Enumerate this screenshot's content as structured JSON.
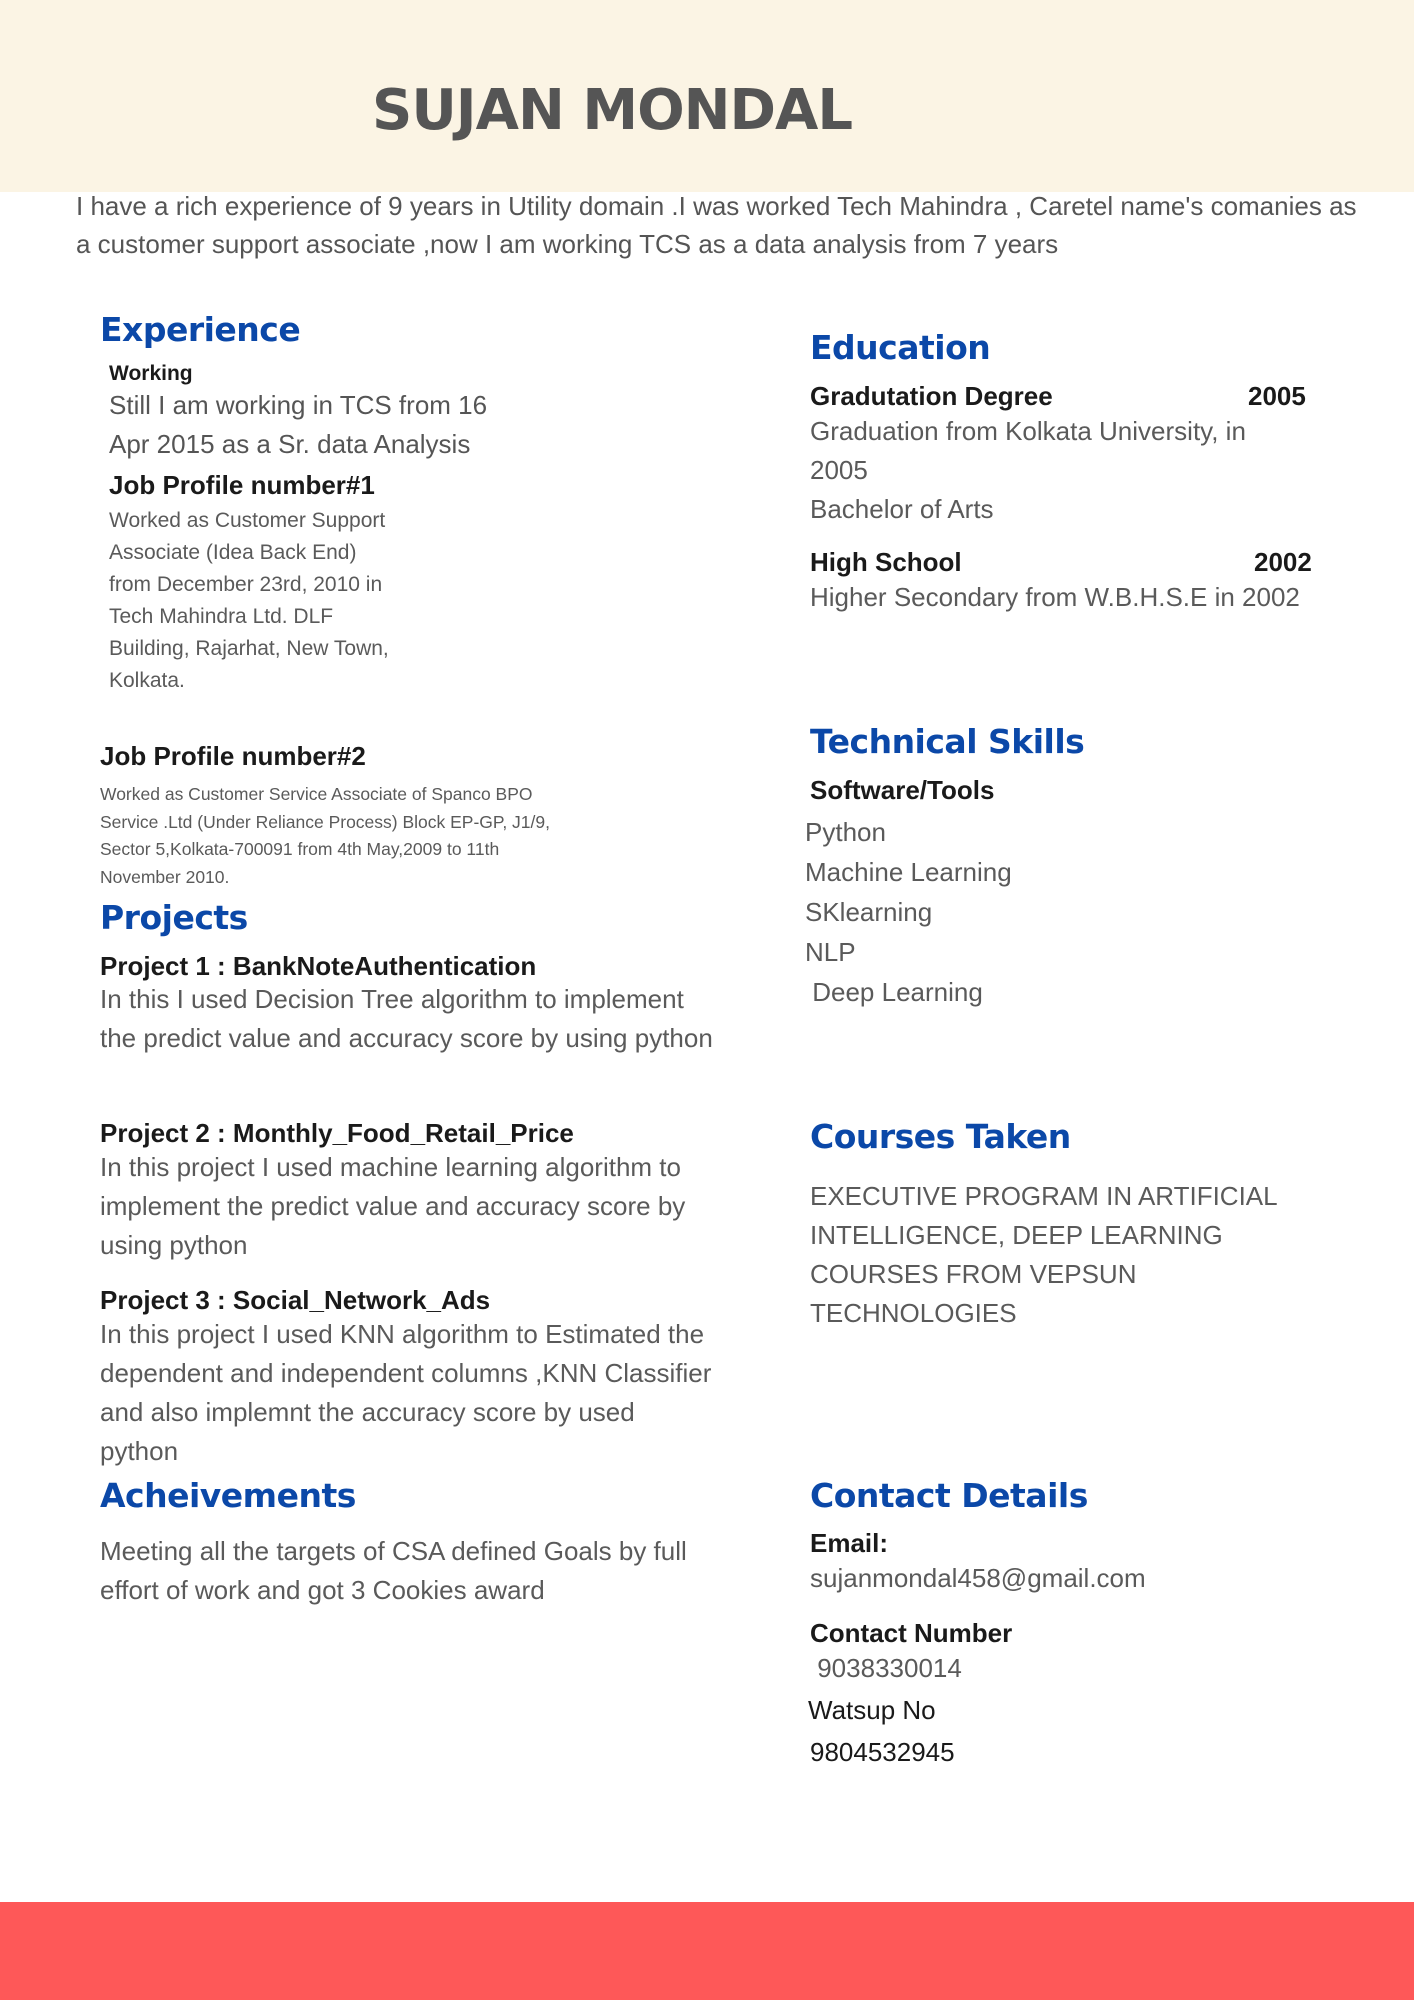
{
  "header": {
    "name": "SUJAN MONDAL",
    "summary": "I have a rich experience of 9 years in  Utility domain .I was worked Tech Mahindra , Caretel  name's comanies as a customer support associate ,now I am working TCS as a data analysis from 7 years"
  },
  "experience": {
    "title": "Experience",
    "working_label": "Working",
    "working_text": "Still I am working in TCS from 16 Apr 2015 as a Sr. data Analysis",
    "job1_title": "Job Profile number#1",
    "job1_text": "Worked as Customer Support Associate (Idea Back End) from December 23rd, 2010 in Tech Mahindra Ltd. DLF Building, Rajarhat, New Town, Kolkata.",
    "job2_title": "Job Profile number#2",
    "job2_text": "Worked as Customer Service Associate of Spanco BPO Service .Ltd (Under Reliance Process) Block EP-GP, J1/9, Sector 5,Kolkata-700091 from 4th May,2009 to 11th November 2010."
  },
  "projects": {
    "title": "Projects",
    "items": [
      {
        "title": "Project 1 : BankNoteAuthentication",
        "text": "In this I used Decision Tree algorithm to implement the predict value and accuracy score by using python"
      },
      {
        "title": "Project  2 : Monthly_Food_Retail_Price",
        "text": "In this project I used machine learning algorithm to implement the predict value and accuracy score by using python"
      },
      {
        "title": "Project 3 : Social_Network_Ads",
        "text": "In this project I used KNN algorithm to Estimated  the dependent and independent columns ,KNN Classifier and also  implemnt the accuracy score by used python"
      }
    ]
  },
  "achievements": {
    "title": "Acheivements",
    "text": "Meeting all the targets of CSA defined Goals by full effort of work and got 3 Cookies award"
  },
  "education": {
    "title": "Education",
    "items": [
      {
        "degree": "Gradutation Degree",
        "year": "2005",
        "text": "Graduation from Kolkata University, in 2005",
        "extra": "Bachelor of Arts"
      },
      {
        "degree": "High School",
        "year": "2002",
        "text": "Higher Secondary from W.B.H.S.E in 2002"
      }
    ]
  },
  "skills": {
    "title": "Technical Skills",
    "subtitle": "Software/Tools",
    "items": [
      "Python",
      "Machine Learning",
      "SKlearning",
      "NLP",
      " Deep Learning"
    ]
  },
  "courses": {
    "title": "Courses Taken",
    "text": "EXECUTIVE PROGRAM IN ARTIFICIAL INTELLIGENCE, DEEP LEARNING COURSES FROM VEPSUN TECHNOLOGIES"
  },
  "contact": {
    "title": "Contact Details",
    "email_label": "Email:",
    "email": "sujanmondal458@gmail.com",
    "number_label": "Contact  Number",
    "number": " 9038330014",
    "whatsapp_label": "Watsup No",
    "whatsapp": "9804532945"
  },
  "colors": {
    "header_band": "#fbf4e4",
    "heading_blue": "#0b48a8",
    "footer_band": "#fe5858"
  }
}
